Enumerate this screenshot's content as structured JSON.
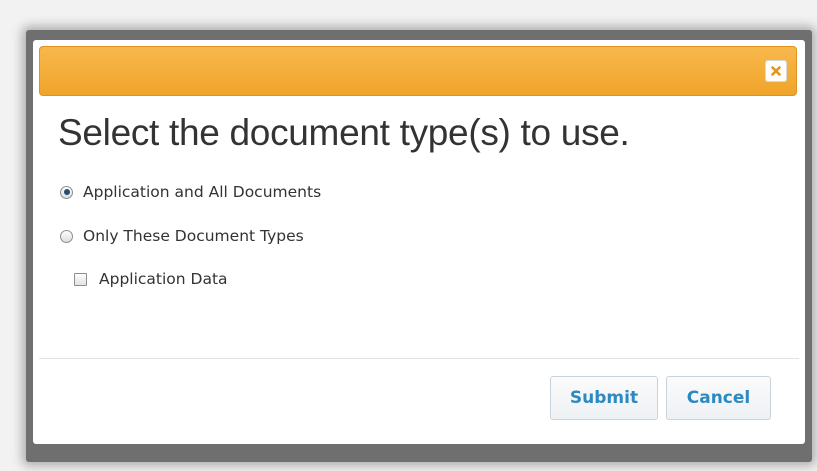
{
  "dialog": {
    "heading": "Select the document type(s) to use.",
    "close_icon": "close-icon",
    "accent_color": "#f0a42a",
    "options": [
      {
        "label": "Application and All Documents",
        "type": "radio",
        "checked": true
      },
      {
        "label": "Only These Document Types",
        "type": "radio",
        "checked": false
      },
      {
        "label": "Application Data",
        "type": "checkbox",
        "checked": false
      }
    ],
    "buttons": {
      "submit": "Submit",
      "cancel": "Cancel"
    },
    "button_text_color": "#2c89c2"
  }
}
